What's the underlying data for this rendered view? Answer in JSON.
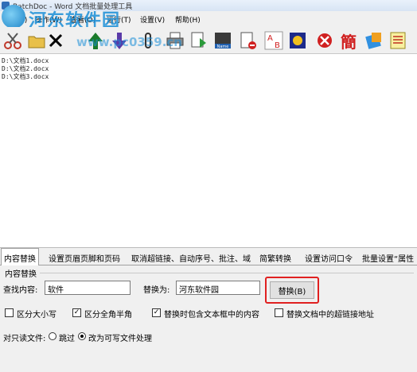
{
  "window": {
    "title": "BatchDoc - Word 文档批量处理工具"
  },
  "watermark": {
    "text": "河东软件园",
    "url": "www.pc0359.cn"
  },
  "menu": [
    {
      "label": "文件(F)"
    },
    {
      "label": "操作(W)"
    },
    {
      "label": "查看(O)"
    },
    {
      "label": "运行(T)"
    },
    {
      "label": "设置(V)"
    },
    {
      "label": "帮助(H)"
    }
  ],
  "toolbar": {
    "icons": [
      "scissors-icon",
      "delete-icon",
      "move-up-icon",
      "move-down-icon",
      "cd-icon",
      "clip-icon",
      "printer-icon",
      "pdf-icon",
      "rename-icon",
      "no-doc-icon",
      "ab-replace-icon",
      "macro-icon",
      "stop-icon",
      "traditional-icon",
      "settings-icon",
      "doc-list-icon",
      "exit-icon"
    ],
    "traditional_glyph": "簡",
    "ab_glyph_a": "A",
    "ab_glyph_b": "B",
    "name_badge": "Name"
  },
  "files": [
    "D:\\文档1.docx",
    "D:\\文档2.docx",
    "D:\\文档3.docx"
  ],
  "tabs": [
    {
      "label": "内容替换"
    },
    {
      "label": "设置页眉页脚和页码"
    },
    {
      "label": "取消超链接、自动序号、批注、域"
    },
    {
      "label": "简繁转换"
    },
    {
      "label": "设置访问口令"
    },
    {
      "label": "批量设置“属性"
    }
  ],
  "replace": {
    "group_label": "内容替换",
    "find_label": "查找内容:",
    "find_value": "软件",
    "replace_label": "替换为:",
    "replace_value": "河东软件园",
    "button_label": "替换(B)"
  },
  "options": {
    "match_case": {
      "label": "区分大小写",
      "checked": false
    },
    "full_half": {
      "label": "区分全角半角",
      "checked": true
    },
    "include_textbox": {
      "label": "替换时包含文本框中的内容",
      "checked": true
    },
    "replace_hyperlink": {
      "label": "替换文档中的超链接地址",
      "checked": false
    }
  },
  "readonly": {
    "label": "对只读文件:",
    "skip_label": "跳过",
    "writable_label": "改为可写文件处理",
    "selected": "writable"
  }
}
